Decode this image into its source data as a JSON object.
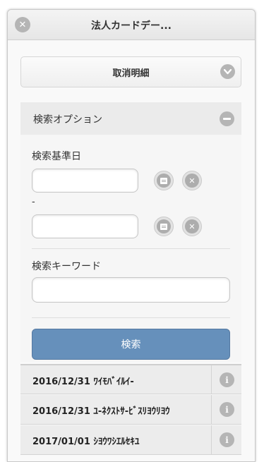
{
  "header": {
    "title": "法人カードデー...",
    "close_icon": "close-icon"
  },
  "collapsible": {
    "label": "取消明細",
    "icon": "chevron-down-icon"
  },
  "search_options": {
    "title": "検索オプション",
    "collapse_icon": "minus-icon",
    "date_label": "検索基準日",
    "date_from": {
      "value": "",
      "placeholder": ""
    },
    "range_separator": "-",
    "date_to": {
      "value": "",
      "placeholder": ""
    },
    "keyword_label": "検索キーワード",
    "keyword": {
      "value": "",
      "placeholder": ""
    },
    "search_button": "検索"
  },
  "results": [
    {
      "text": "2016/12/31 ﾜｲﾓﾊﾞｲﾙｲ-"
    },
    {
      "text": "2016/12/31 ﾕ-ﾈｸｽﾄｻ-ﾋﾞｽﾘﾖｳﾘﾖｳ"
    },
    {
      "text": "2017/01/01 ｼﾖｳﾜｼｴﾙｾｷﾕ"
    }
  ],
  "colors": {
    "accent": "#6690bb",
    "icon_gray": "#b5b5b5"
  }
}
